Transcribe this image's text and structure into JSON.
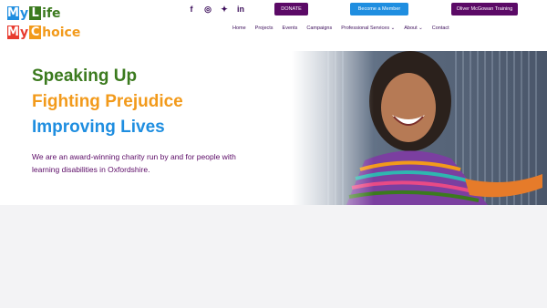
{
  "logo": {
    "line1": [
      {
        "letter": "M",
        "color": "#1f8ee0"
      },
      {
        "letter": "y",
        "text": true
      },
      {
        "letter": "L",
        "color": "#3b7a1e"
      },
      {
        "letter": "ife",
        "text": true
      }
    ],
    "line2": [
      {
        "letter": "M",
        "color": "#e83a2e"
      },
      {
        "letter": "y",
        "text": true
      },
      {
        "letter": "C",
        "color": "#f29a1b"
      },
      {
        "letter": "hoice",
        "text": true
      }
    ],
    "l1_a": "M",
    "l1_b": "y",
    "l1_c": "L",
    "l1_d": "ife",
    "l2_a": "M",
    "l2_b": "y",
    "l2_c": "C",
    "l2_d": "hoice"
  },
  "socials": [
    {
      "icon": "facebook-icon",
      "glyph": "f"
    },
    {
      "icon": "instagram-icon",
      "glyph": "◎"
    },
    {
      "icon": "bluesky-icon",
      "glyph": "✦"
    },
    {
      "icon": "linkedin-icon",
      "glyph": "in"
    }
  ],
  "buttons": {
    "donate": "DONATE",
    "member": "Become a Member",
    "training": "Oliver McGowan Training"
  },
  "nav": {
    "home": "Home",
    "projects": "Projects",
    "events": "Events",
    "campaigns": "Campaigns",
    "professional": "Professional Services ⌄",
    "about": "About ⌄",
    "contact": "Contact"
  },
  "hero": {
    "line1": "Speaking Up",
    "line2": "Fighting Prejudice",
    "line3": "Improving Lives",
    "intro": "We are an award-winning charity run by and for people with learning disabilities in Oxfordshire."
  },
  "colors": {
    "green": "#3b7a1e",
    "orange": "#f29a1b",
    "blue": "#1f8ee0",
    "purple": "#5b0a66",
    "red": "#e83a2e"
  }
}
